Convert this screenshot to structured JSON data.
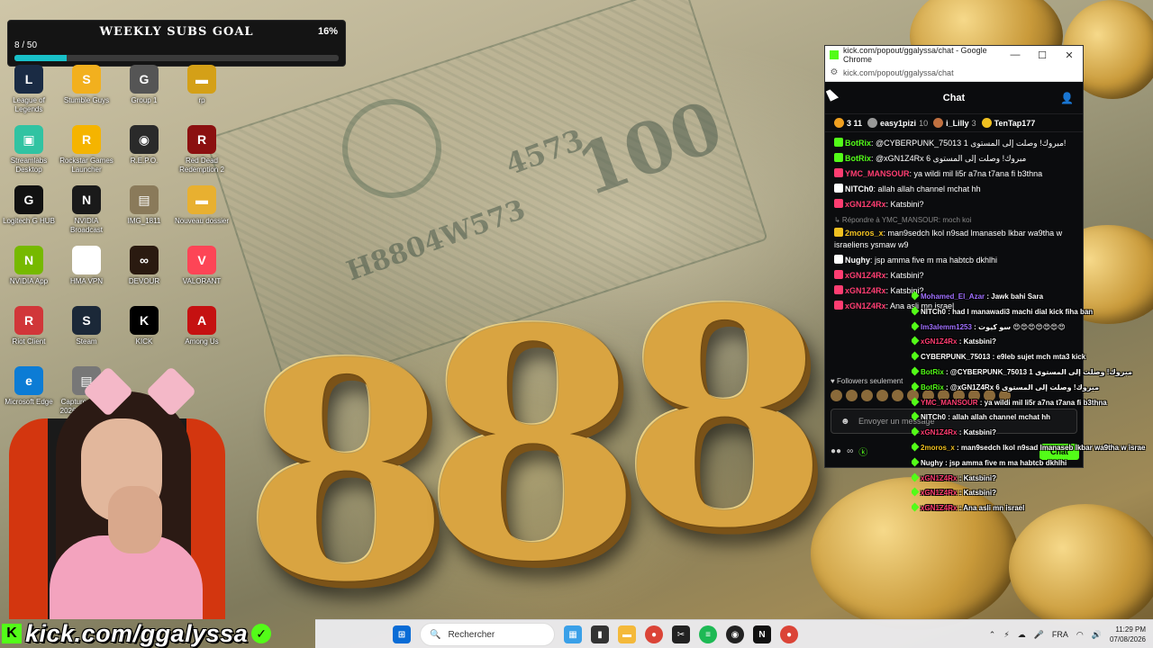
{
  "subs_goal": {
    "title": "WEEKLY SUBS GOAL",
    "count": "8 / 50",
    "percent": "16%",
    "progress": 0.16
  },
  "desktop_icons": [
    {
      "label": "League of Legends",
      "color": "#1a2b44",
      "glyph": "L"
    },
    {
      "label": "Stumble Guys",
      "color": "#f2b01e",
      "glyph": "S"
    },
    {
      "label": "Group 1",
      "color": "#555555",
      "glyph": "G"
    },
    {
      "label": "rp",
      "color": "#d4a017",
      "glyph": "▬"
    },
    {
      "label": "Streamlabs Desktop",
      "color": "#31c3a2",
      "glyph": "▣"
    },
    {
      "label": "Rockstar Games Launcher",
      "color": "#f5b400",
      "glyph": "R"
    },
    {
      "label": "R.E.P.O.",
      "color": "#2a2a2a",
      "glyph": "◉"
    },
    {
      "label": "Red Dead Redemption 2",
      "color": "#8b1010",
      "glyph": "R"
    },
    {
      "label": "Logitech G HUB",
      "color": "#111111",
      "glyph": "G"
    },
    {
      "label": "NVIDIA Broadcast",
      "color": "#1a1a1a",
      "glyph": "N"
    },
    {
      "label": "IMG_1811",
      "color": "#8a7a5a",
      "glyph": "▤"
    },
    {
      "label": "Nouveau dossier",
      "color": "#e8b030",
      "glyph": "▬"
    },
    {
      "label": "NVIDIA App",
      "color": "#76b900",
      "glyph": "N"
    },
    {
      "label": "HMA VPN",
      "color": "#ffffff",
      "glyph": "H"
    },
    {
      "label": "DEVOUR",
      "color": "#2a1a10",
      "glyph": "∞"
    },
    {
      "label": "VALORANT",
      "color": "#fd4556",
      "glyph": "V"
    },
    {
      "label": "Riot Client",
      "color": "#d13639",
      "glyph": "R"
    },
    {
      "label": "Steam",
      "color": "#1b2838",
      "glyph": "S"
    },
    {
      "label": "KICK",
      "color": "#000000",
      "glyph": "K"
    },
    {
      "label": "Among Us",
      "color": "#c51111",
      "glyph": "A"
    },
    {
      "label": "Microsoft Edge",
      "color": "#0c7cd5",
      "glyph": "e"
    },
    {
      "label": "Capture d'écran 2026-08-05 02...",
      "color": "#777777",
      "glyph": "▤"
    }
  ],
  "chrome": {
    "title": "kick.com/popout/ggalyssa/chat - Google Chrome",
    "url": "kick.com/popout/ggalyssa/chat",
    "minimize": "—",
    "maximize": "☐",
    "close": "✕"
  },
  "chat": {
    "header": "Chat",
    "leaderboard": [
      {
        "name": "3 11",
        "color": "#f0a020"
      },
      {
        "name": "easy1pizi",
        "count": "10",
        "color": "#999999"
      },
      {
        "name": "i_Lilly",
        "count": "3",
        "color": "#c07040"
      },
      {
        "name": "TenTap177",
        "count": "",
        "color": "#f0c020"
      }
    ],
    "messages": [
      {
        "user": "BotRix",
        "color": "#53fc18",
        "text": "@CYBERPUNK_75013 مبروك! وصلت إلى المستوى 1!"
      },
      {
        "user": "BotRix",
        "color": "#53fc18",
        "text": "@xGN1Z4Rx مبروك! وصلت إلى المستوى 6"
      },
      {
        "user": "YMC_MANSOUR",
        "color": "#ff3d71",
        "text": "ya wildi mil li5r a7na t7ana fi b3thna"
      },
      {
        "user": "NITCh0",
        "color": "#ffffff",
        "text": "allah allah channel mchat hh"
      },
      {
        "user": "xGN1Z4Rx",
        "color": "#ff3d71",
        "text": "Katsbini?"
      },
      {
        "reply": "Répondre à YMC_MANSOUR: moch koi"
      },
      {
        "user": "2moros_x",
        "color": "#f0c020",
        "text": "man9sedch lkol n9sad lmanaseb lkbar wa9tha w israeliens ysmaw w9"
      },
      {
        "user": "Nughy",
        "color": "#ffffff",
        "text": "jsp amma five m ma habtcb dkhlhi"
      },
      {
        "user": "xGN1Z4Rx",
        "color": "#ff3d71",
        "text": "Katsbini?"
      },
      {
        "user": "xGN1Z4Rx",
        "color": "#ff3d71",
        "text": "Katsbini?"
      },
      {
        "user": "xGN1Z4Rx",
        "color": "#ff3d71",
        "text": "Ana asli mn israel"
      }
    ],
    "followers_only": "Followers seulement",
    "input_placeholder": "Envoyer un message",
    "send_label": "Chat"
  },
  "overlay_chat": [
    {
      "user": "Mohamed_El_Azar",
      "color": "#a070ff",
      "text": "Jawk bahi Sara"
    },
    {
      "user": "NITCh0",
      "color": "#ffffff",
      "text": "had l manawadi3 machi dial kick fiha ban"
    },
    {
      "user": "Im3alemm1253",
      "color": "#a070ff",
      "text": "سو كيوت 😍😍😍😍😍😍😍"
    },
    {
      "user": "xGN1Z4Rx",
      "color": "#ff3d71",
      "text": "Katsbini?"
    },
    {
      "user": "CYBERPUNK_75013",
      "color": "#ffffff",
      "text": "e9leb sujet mch mta3 kick"
    },
    {
      "user": "BotRix",
      "color": "#53fc18",
      "text": "@CYBERPUNK_75013 مبروك! وصلت إلى المستوى 1"
    },
    {
      "user": "BotRix",
      "color": "#53fc18",
      "text": "@xGN1Z4Rx مبروك! وصلت إلى المستوى 6"
    },
    {
      "user": "YMC_MANSOUR",
      "color": "#ff3d71",
      "text": "ya wildi mil li5r a7na t7ana fi b3thna"
    },
    {
      "user": "NITCh0",
      "color": "#ffffff",
      "text": "allah allah channel mchat hh"
    },
    {
      "user": "xGN1Z4Rx",
      "color": "#ff3d71",
      "text": "Katsbini?"
    },
    {
      "user": "2moros_x",
      "color": "#f0c020",
      "text": "man9sedch lkol n9sad lmanaseb lkbar wa9tha w israe"
    },
    {
      "user": "Nughy",
      "color": "#ffffff",
      "text": "jsp amma five m ma habtcb dkhlhi"
    },
    {
      "user": "xGN1Z4Rx",
      "color": "#ff3d71",
      "text": "Katsbini?"
    },
    {
      "user": "xGN1Z4Rx",
      "color": "#ff3d71",
      "text": "Katsbini?"
    },
    {
      "user": "xGN1Z4Rx",
      "color": "#ff3d71",
      "text": "Ana asli mn israel"
    }
  ],
  "kick_banner": {
    "url": "kick.com/ggalyssa"
  },
  "taskbar": {
    "search_placeholder": "Rechercher",
    "language": "FRA",
    "time": "11:29 PM",
    "date": "07/08/2026"
  }
}
